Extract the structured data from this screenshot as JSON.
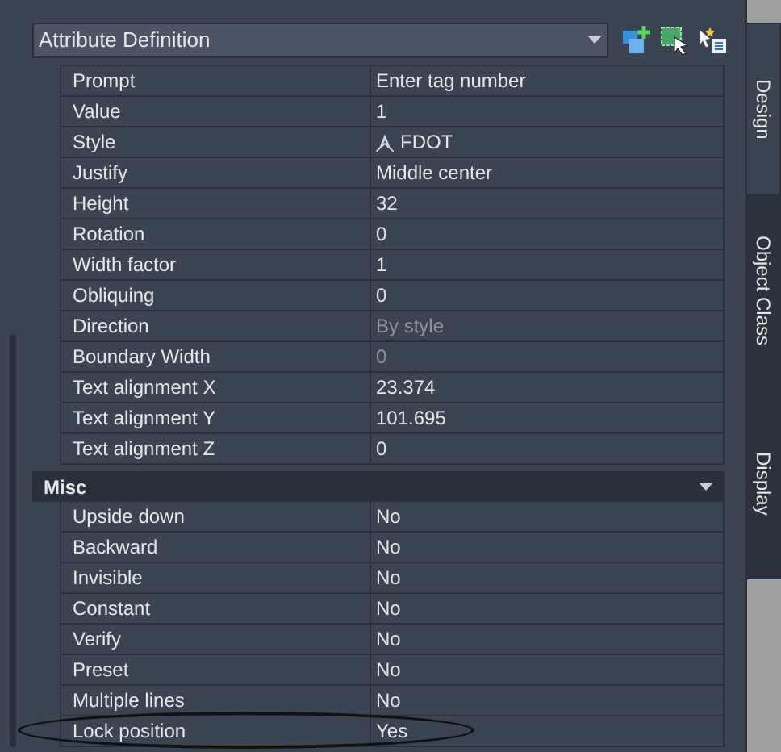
{
  "dropdown": {
    "value": "Attribute Definition"
  },
  "properties": [
    {
      "label": "Prompt",
      "value": "Enter tag number",
      "kind": "text",
      "disabled": false
    },
    {
      "label": "Value",
      "value": "1",
      "kind": "text",
      "disabled": false
    },
    {
      "label": "Style",
      "value": "FDOT",
      "kind": "style",
      "disabled": false
    },
    {
      "label": "Justify",
      "value": "Middle center",
      "kind": "text",
      "disabled": false
    },
    {
      "label": "Height",
      "value": "32",
      "kind": "text",
      "disabled": false
    },
    {
      "label": "Rotation",
      "value": "0",
      "kind": "text",
      "disabled": false
    },
    {
      "label": "Width factor",
      "value": "1",
      "kind": "text",
      "disabled": false
    },
    {
      "label": "Obliquing",
      "value": "0",
      "kind": "text",
      "disabled": false
    },
    {
      "label": "Direction",
      "value": "By style",
      "kind": "text",
      "disabled": true
    },
    {
      "label": "Boundary Width",
      "value": "0",
      "kind": "text",
      "disabled": true
    },
    {
      "label": "Text alignment X",
      "value": "23.374",
      "kind": "text",
      "disabled": false
    },
    {
      "label": "Text alignment Y",
      "value": "101.695",
      "kind": "text",
      "disabled": false
    },
    {
      "label": "Text alignment Z",
      "value": "0",
      "kind": "text",
      "disabled": false
    }
  ],
  "misc": {
    "title": "Misc",
    "expanded": true,
    "rows": [
      {
        "label": "Upside down",
        "value": "No",
        "circled": false
      },
      {
        "label": "Backward",
        "value": "No",
        "circled": false
      },
      {
        "label": "Invisible",
        "value": "No",
        "circled": false
      },
      {
        "label": "Constant",
        "value": "No",
        "circled": false
      },
      {
        "label": "Verify",
        "value": "No",
        "circled": false
      },
      {
        "label": "Preset",
        "value": "No",
        "circled": false
      },
      {
        "label": "Multiple lines",
        "value": "No",
        "circled": false
      },
      {
        "label": "Lock position",
        "value": "Yes",
        "circled": true
      }
    ]
  },
  "tabs": [
    {
      "label": "Design",
      "selected": true
    },
    {
      "label": "Object Class",
      "selected": false
    },
    {
      "label": "Display",
      "selected": false
    }
  ]
}
